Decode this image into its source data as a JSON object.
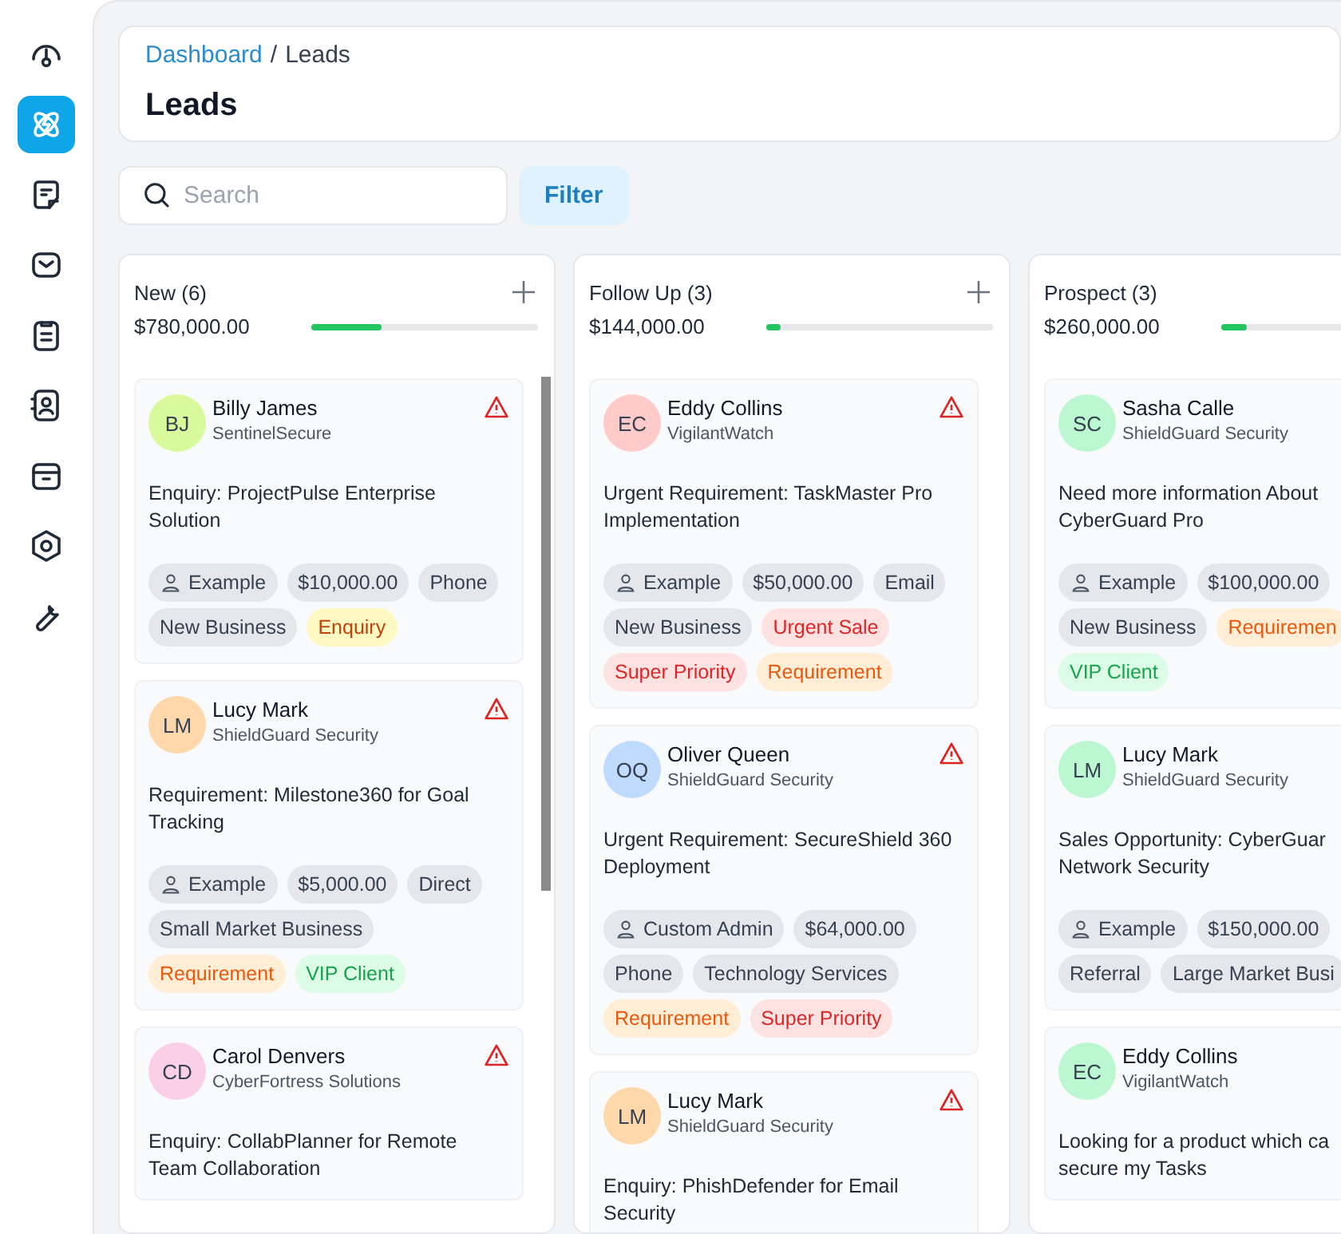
{
  "sidebar": {
    "items": [
      {
        "selected": false
      },
      {
        "selected": true
      },
      {
        "selected": false
      },
      {
        "selected": false
      },
      {
        "selected": false
      },
      {
        "selected": false
      },
      {
        "selected": false
      },
      {
        "selected": false
      },
      {
        "selected": false
      }
    ]
  },
  "header": {
    "breadcrumb": {
      "link": "Dashboard",
      "separator": "/",
      "current": "Leads"
    },
    "title": "Leads"
  },
  "toolbar": {
    "search": {
      "placeholder": "Search"
    },
    "filter_button": "Filter"
  },
  "columns": [
    {
      "title": "New (6)",
      "total": "$780,000.00",
      "level": 0.31,
      "add": true,
      "scrollbar": true,
      "cards": [
        {
          "initials": "BJ",
          "color": "#d9f99d",
          "name": "Billy James",
          "company": "SentinelSecure",
          "subject": "Enquiry: ProjectPulse Enterprise Solution",
          "tags": [
            {
              "kind": "owner",
              "text": "Example"
            },
            {
              "kind": "plain",
              "text": "$10,000.00"
            },
            {
              "kind": "plain",
              "text": "Phone"
            },
            {
              "kind": "plain",
              "text": "New Business"
            },
            {
              "kind": "yellow",
              "text": "Enquiry"
            }
          ]
        },
        {
          "initials": "LM",
          "color": "#fed7aa",
          "name": "Lucy Mark",
          "company": "ShieldGuard Security",
          "subject": "Requirement: Milestone360 for Goal Tracking",
          "tags": [
            {
              "kind": "owner",
              "text": "Example"
            },
            {
              "kind": "plain",
              "text": "$5,000.00"
            },
            {
              "kind": "plain",
              "text": "Direct"
            },
            {
              "kind": "plain",
              "text": "Small Market Business"
            },
            {
              "kind": "orange",
              "text": "Requirement"
            },
            {
              "kind": "green",
              "text": "VIP Client"
            }
          ]
        },
        {
          "initials": "CD",
          "color": "#fbcfe8",
          "name": "Carol Denvers",
          "company": "CyberFortress Solutions",
          "subject": "Enquiry: CollabPlanner for Remote Team Collaboration"
        }
      ]
    },
    {
      "title": "Follow Up (3)",
      "total": "$144,000.00",
      "level": 0.06,
      "add": true,
      "scrollbar": false,
      "cards": [
        {
          "initials": "EC",
          "color": "#fecaca",
          "name": "Eddy Collins",
          "company": "VigilantWatch",
          "subject": "Urgent Requirement: TaskMaster Pro Implementation",
          "tags": [
            {
              "kind": "owner",
              "text": "Example"
            },
            {
              "kind": "plain",
              "text": "$50,000.00"
            },
            {
              "kind": "plain",
              "text": "Email"
            },
            {
              "kind": "plain",
              "text": "New Business"
            },
            {
              "kind": "red",
              "text": "Urgent Sale"
            },
            {
              "kind": "red",
              "text": "Super Priority"
            },
            {
              "kind": "orange",
              "text": "Requirement"
            }
          ]
        },
        {
          "initials": "OQ",
          "color": "#bfdbfe",
          "name": "Oliver Queen",
          "company": "ShieldGuard Security",
          "subject": "Urgent Requirement: SecureShield 360 Deployment",
          "tags": [
            {
              "kind": "owner",
              "text": "Custom Admin"
            },
            {
              "kind": "plain",
              "text": "$64,000.00"
            },
            {
              "kind": "plain",
              "text": "Phone"
            },
            {
              "kind": "plain",
              "text": "Technology Services"
            },
            {
              "kind": "orange",
              "text": "Requirement"
            },
            {
              "kind": "red",
              "text": "Super Priority"
            }
          ]
        },
        {
          "initials": "LM",
          "color": "#fed7aa",
          "name": "Lucy Mark",
          "company": "ShieldGuard Security",
          "subject": "Enquiry: PhishDefender for Email Security"
        }
      ]
    },
    {
      "title": "Prospect (3)",
      "total": "$260,000.00",
      "level": 0.11,
      "cards": [
        {
          "initials": "SC",
          "color": "#bbf7d0",
          "name": "Sasha Calle",
          "company": "ShieldGuard Security",
          "subject": "Need more information About\nCyberGuard Pro",
          "tags": [
            {
              "kind": "owner",
              "text": "Example"
            },
            {
              "kind": "plain",
              "text": "$100,000.00"
            },
            {
              "kind": "plain",
              "text": "New Business"
            },
            {
              "kind": "orange",
              "text": "Requiremen"
            },
            {
              "kind": "green",
              "text": "VIP Client"
            }
          ]
        },
        {
          "initials": "LM",
          "color": "#bbf7d0",
          "name": "Lucy Mark",
          "company": "ShieldGuard Security",
          "subject": "Sales Opportunity: CyberGuar\nNetwork Security",
          "tags": [
            {
              "kind": "owner",
              "text": "Example"
            },
            {
              "kind": "plain",
              "text": "$150,000.00"
            },
            {
              "kind": "plain",
              "text": "Referral"
            },
            {
              "kind": "plain",
              "text": "Large Market Busi"
            }
          ]
        },
        {
          "initials": "EC",
          "color": "#bbf7d0",
          "name": "Eddy Collins",
          "company": "VigilantWatch",
          "subject": "Looking for a product which ca\nsecure my Tasks"
        }
      ]
    }
  ]
}
